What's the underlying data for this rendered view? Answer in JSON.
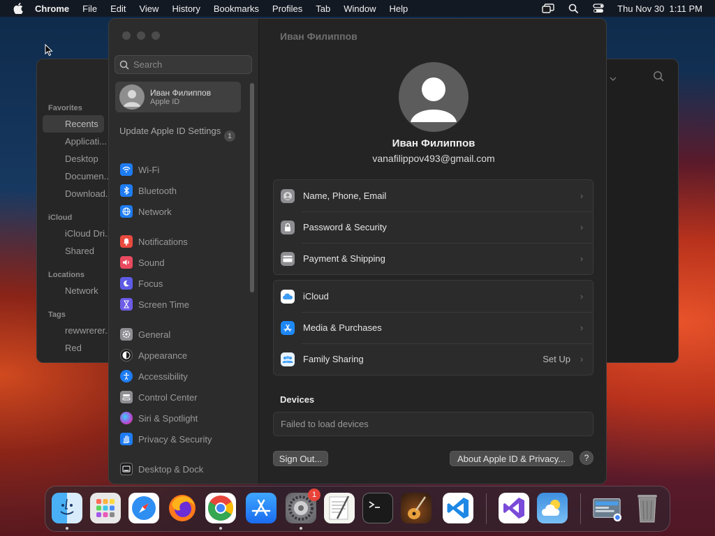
{
  "menubar": {
    "app_name": "Chrome",
    "menus": [
      "File",
      "Edit",
      "View",
      "History",
      "Bookmarks",
      "Profiles",
      "Tab",
      "Window",
      "Help"
    ],
    "datetime": "Thu Nov 30  1:11 PM"
  },
  "finder": {
    "sections": {
      "favorites": "Favorites",
      "icloud": "iCloud",
      "locations": "Locations",
      "tags": "Tags"
    },
    "favorites": [
      "Recents",
      "Applicati...",
      "Desktop",
      "Documen...",
      "Download..."
    ],
    "icloud": [
      "iCloud Dri...",
      "Shared"
    ],
    "locations": [
      "Network"
    ],
    "tags": [
      "rewwrerer...",
      "Red"
    ]
  },
  "settings": {
    "window_title": "Иван Филиппов",
    "search_placeholder": "Search",
    "account": {
      "name": "Иван Филиппов",
      "sub": "Apple ID"
    },
    "update_text": "Update Apple ID Settings",
    "update_badge": "1",
    "nav": [
      {
        "label": "Wi-Fi",
        "icon": "wifi-icon",
        "color": "#1e7cf2"
      },
      {
        "label": "Bluetooth",
        "icon": "bluetooth-icon",
        "color": "#1e7cf2"
      },
      {
        "label": "Network",
        "icon": "globe-icon",
        "color": "#1e7cf2"
      },
      {
        "label": "Notifications",
        "icon": "bell-icon",
        "color": "#e84a3f"
      },
      {
        "label": "Sound",
        "icon": "speaker-icon",
        "color": "#e84a5f"
      },
      {
        "label": "Focus",
        "icon": "moon-icon",
        "color": "#5e5ce6"
      },
      {
        "label": "Screen Time",
        "icon": "hourglass-icon",
        "color": "#6c5ce6"
      },
      {
        "label": "General",
        "icon": "gear-icon",
        "color": "#8e8e93"
      },
      {
        "label": "Appearance",
        "icon": "appearance-icon",
        "color": "#2c2c2e"
      },
      {
        "label": "Accessibility",
        "icon": "accessibility-icon",
        "color": "#1e7cf2"
      },
      {
        "label": "Control Center",
        "icon": "control-center-icon",
        "color": "#8e8e93"
      },
      {
        "label": "Siri & Spotlight",
        "icon": "siri-icon",
        "color": "#b14ad6"
      },
      {
        "label": "Privacy & Security",
        "icon": "hand-icon",
        "color": "#1e7cf2"
      },
      {
        "label": "Desktop & Dock",
        "icon": "dock-icon",
        "color": "#2c2c2e"
      }
    ],
    "profile": {
      "name": "Иван Филиппов",
      "email": "vanafilippov493@gmail.com"
    },
    "group1": [
      {
        "label": "Name, Phone, Email",
        "icon": "contact-icon",
        "color": "#8e8e93"
      },
      {
        "label": "Password & Security",
        "icon": "lock-icon",
        "color": "#8e8e93"
      },
      {
        "label": "Payment & Shipping",
        "icon": "card-icon",
        "color": "#8e8e93"
      }
    ],
    "group2": [
      {
        "label": "iCloud",
        "icon": "icloud-icon",
        "color": "#ffffff",
        "value": ""
      },
      {
        "label": "Media & Purchases",
        "icon": "appstore-icon",
        "color": "#1e7cf2",
        "value": ""
      },
      {
        "label": "Family Sharing",
        "icon": "family-icon",
        "color": "#ffffff",
        "value": "Set Up"
      }
    ],
    "devices_title": "Devices",
    "devices_message": "Failed to load devices",
    "sign_out": "Sign Out...",
    "about": "About Apple ID & Privacy...",
    "help": "?"
  },
  "dock": {
    "apps": [
      {
        "name": "finder",
        "color": "#3b8fe8",
        "running": true
      },
      {
        "name": "launchpad",
        "color": "#dcdcdc",
        "running": false
      },
      {
        "name": "safari",
        "color": "#2f8ef2",
        "running": false
      },
      {
        "name": "firefox",
        "color": "#ff7a1a",
        "running": false
      },
      {
        "name": "chrome",
        "color": "#ffffff",
        "running": true
      },
      {
        "name": "app-store",
        "color": "#1e88f5",
        "running": false
      },
      {
        "name": "system-settings",
        "color": "#8e8e93",
        "running": true,
        "badge": "1"
      },
      {
        "name": "textedit",
        "color": "#f5f5f0",
        "running": false
      },
      {
        "name": "terminal",
        "color": "#1a1a1a",
        "running": false
      },
      {
        "name": "garageband",
        "color": "#3a2a1a",
        "running": false
      },
      {
        "name": "vscode",
        "color": "#ffffff",
        "running": false
      },
      {
        "name": "visual-studio",
        "color": "#ffffff",
        "running": false
      },
      {
        "name": "weather",
        "color": "#3e8fe0",
        "running": false
      },
      {
        "name": "downloads-stack",
        "color": "#6a7d8e",
        "running": false
      },
      {
        "name": "trash",
        "color": "#7a7a7a",
        "running": false
      }
    ]
  }
}
